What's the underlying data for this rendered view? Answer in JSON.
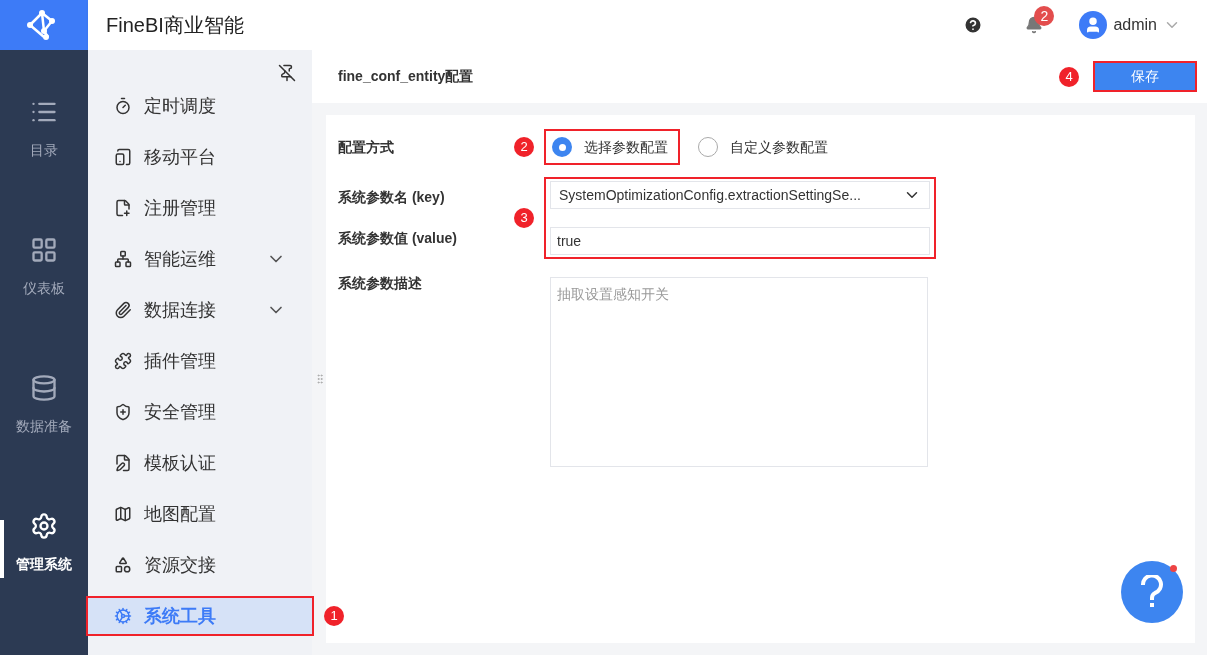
{
  "app": {
    "title": "FineBI商业智能"
  },
  "header": {
    "notifications": "2",
    "user": "admin"
  },
  "rail": [
    {
      "label": "目录",
      "selected": false
    },
    {
      "label": "仪表板",
      "selected": false
    },
    {
      "label": "数据准备",
      "selected": false
    },
    {
      "label": "管理系统",
      "selected": true
    }
  ],
  "sidebar": [
    {
      "label": "定时调度",
      "expandable": false,
      "selected": false
    },
    {
      "label": "移动平台",
      "expandable": false,
      "selected": false
    },
    {
      "label": "注册管理",
      "expandable": false,
      "selected": false
    },
    {
      "label": "智能运维",
      "expandable": true,
      "selected": false
    },
    {
      "label": "数据连接",
      "expandable": true,
      "selected": false
    },
    {
      "label": "插件管理",
      "expandable": false,
      "selected": false
    },
    {
      "label": "安全管理",
      "expandable": false,
      "selected": false
    },
    {
      "label": "模板认证",
      "expandable": false,
      "selected": false
    },
    {
      "label": "地图配置",
      "expandable": false,
      "selected": false
    },
    {
      "label": "资源交接",
      "expandable": false,
      "selected": false
    },
    {
      "label": "系统工具",
      "expandable": false,
      "selected": true,
      "callout": "1"
    }
  ],
  "content": {
    "title": "fine_conf_entity配置",
    "save_button": "保存",
    "save_callout": "4",
    "mode": {
      "label": "配置方式",
      "callout": "2",
      "options": [
        {
          "label": "选择参数配置",
          "selected": true
        },
        {
          "label": "自定义参数配置",
          "selected": false
        }
      ]
    },
    "fields_callout": "3",
    "key": {
      "label": "系统参数名 (key)",
      "value": "SystemOptimizationConfig.extractionSettingSe..."
    },
    "value": {
      "label": "系统参数值 (value)",
      "value": "true"
    },
    "description": {
      "label": "系统参数描述",
      "placeholder": "抽取设置感知开关"
    }
  }
}
